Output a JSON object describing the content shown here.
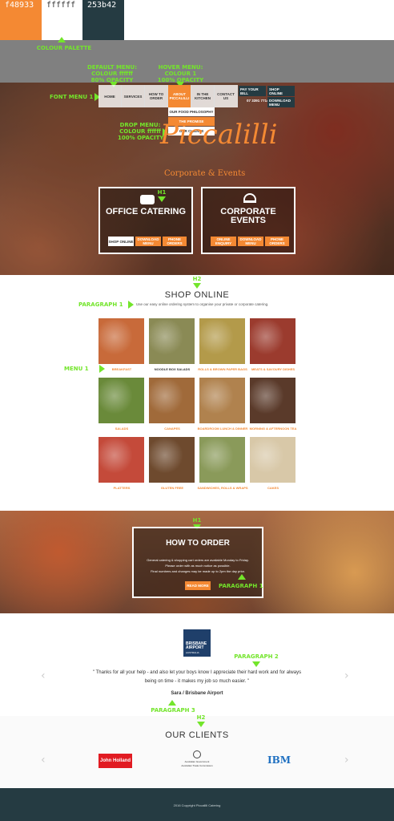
{
  "palette": {
    "colors": [
      {
        "hex": "#f48933",
        "label": "f48933"
      },
      {
        "hex": "#ffffff",
        "label": "ffffff"
      },
      {
        "hex": "#253b42",
        "label": "253b42"
      }
    ],
    "annotation": "COLOUR PALETTE"
  },
  "annotations": {
    "default_menu": "DEFAULT MENU:\nCOLOUR ffffff\n80% OPACITY",
    "hover_menu": "HOVER MENU:\nCOLOUR 1\n100% OPACITY",
    "font_menu": "FONT MENU 1",
    "drop_menu": "DROP MENU:\nCOLOUR ffffff\n100% OPACITY",
    "h1_a": "H1",
    "h2_a": "H2",
    "paragraph1": "PARAGRAPH 1",
    "menu1": "MENU 1",
    "h1_b": "H1",
    "paragraph1_b": "PARAGRAPH 1",
    "paragraph2": "PARAGRAPH 2",
    "paragraph3": "PARAGRAPH 3",
    "h2_b": "H2"
  },
  "nav": {
    "items": [
      "HOME",
      "SERVICES",
      "HOW TO ORDER",
      "ABOUT PICCALILLI",
      "IN THE KITCHEN",
      "CONTACT US"
    ],
    "active_index": 3,
    "dropdown": [
      "OUR FOOD PHILOSOPHY",
      "THE PROMISE",
      "OUR CLIENTS"
    ],
    "dropdown_active_index": 1,
    "pay": "PAY YOUR BILL",
    "phone": "07 3391 7714",
    "shop": "SHOP ONLINE",
    "download": "DOWNLOAD MENU"
  },
  "logo": {
    "script": "Piccalilli",
    "subtitle": "Corporate & Events"
  },
  "cta": {
    "office": {
      "title": "OFFICE CATERING",
      "buttons": [
        "SHOP ONLINE",
        "DOWNLOAD MENU",
        "PHONE ORDERS"
      ]
    },
    "events": {
      "title": "CORPORATE EVENTS",
      "buttons": [
        "ONLINE ENQUIRY",
        "DOWNLOAD MENU",
        "PHONE ORDERS"
      ]
    }
  },
  "shop": {
    "title": "SHOP ONLINE",
    "intro": "Use our easy online ordering system to organise your private or corporate catering.",
    "items": [
      {
        "label": "BREAKFAST",
        "color": "#c86a3a"
      },
      {
        "label": "NOODLE BOX SALADS",
        "color": "#8a8a55"
      },
      {
        "label": "ROLLS & BROWN PAPER BAGS",
        "color": "#b39a4a"
      },
      {
        "label": "MEATS & SAVOURY DISHES",
        "color": "#9b3b2e"
      },
      {
        "label": "SALADS",
        "color": "#6a8a3a"
      },
      {
        "label": "CANAPES",
        "color": "#a06a3a"
      },
      {
        "label": "BOARDROOM LUNCH & DINNER",
        "color": "#b0824e"
      },
      {
        "label": "MORNING & AFTERNOON TEA",
        "color": "#5a3a2a"
      },
      {
        "label": "PLATTERS",
        "color": "#c44a3a"
      },
      {
        "label": "GLUTEN FREE",
        "color": "#6e4a2e"
      },
      {
        "label": "SANDWICHES, ROLLS & WRAPS",
        "color": "#8a9a5a"
      },
      {
        "label": "CAKES",
        "color": "#d8c8a8"
      }
    ]
  },
  "order": {
    "title": "HOW TO ORDER",
    "lines": [
      "General catering & shopping cart orders are available Monday to Friday.",
      "Please order with as much notice as possible.",
      "Final numbers and changes may be made up to 2pm the day prior."
    ],
    "button": "READ MORE"
  },
  "testimonial": {
    "logo_line1": "BRISBANE",
    "logo_line2": "AIRPORT",
    "logo_line3": "AUSTRALIA",
    "quote": "\" Thanks for all your help - and also let your boys know I appreciate their hard work and for always being on time - it makes my job so much easier. \"",
    "author": "Sara / Brisbane Airport"
  },
  "clients": {
    "title": "OUR CLIENTS",
    "logos": [
      "John Holland",
      "Australian Government",
      "IBM"
    ],
    "logo_sub": "Australian Trade Commission"
  },
  "footer": {
    "text": "2016 Copyright Piccalilli Catering"
  },
  "arrows": {
    "left": "‹",
    "right": "›"
  }
}
